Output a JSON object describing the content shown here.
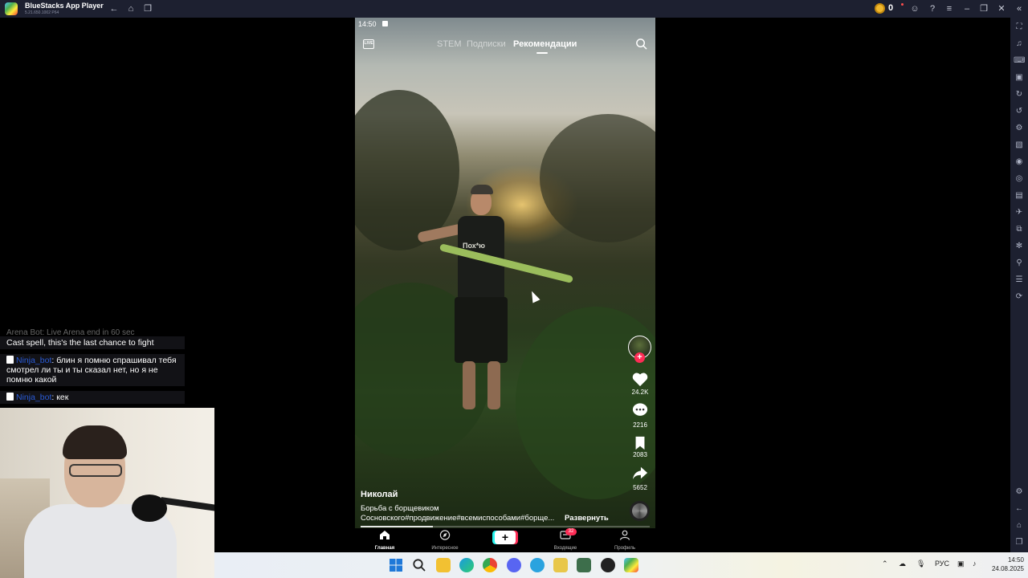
{
  "window": {
    "title": "BlueStacks App Player",
    "version": "5.21.650.1002 P64",
    "coins": "0"
  },
  "phone": {
    "status_time": "14:50",
    "tabs": [
      {
        "label": "STEM",
        "active": false
      },
      {
        "label": "Подписки",
        "active": false
      },
      {
        "label": "Рекомендации",
        "active": true
      }
    ],
    "live_label": "LIVE",
    "shirt_text": "Пох*ю",
    "actions": {
      "likes": "24.2K",
      "comments": "2216",
      "saves": "2083",
      "shares": "5652"
    },
    "author": "Николай",
    "description_line1": "Борьба с борщевиком",
    "description_line2": "Сосновского#продвижение#всемиспособами#борще...",
    "expand_label": "Развернуть",
    "progress": 0.25,
    "nav": [
      {
        "label": "Главная",
        "active": true
      },
      {
        "label": "Интересное",
        "active": false
      },
      {
        "label": "Входящие",
        "active": false
      },
      {
        "label": "Профиль",
        "active": false
      }
    ],
    "inbox_badge": "32",
    "create_label": "+"
  },
  "chat": {
    "faded_line": "Arena Bot: Live Arena end in 60 sec",
    "lines": [
      {
        "user": "",
        "text": "Cast spell, this's the last chance to fight"
      },
      {
        "user": "Ninja_bot",
        "text": ": блин я помню спрашивал тебя смотрел ли ты и ты сказал нет, но я не помню какой"
      },
      {
        "user": "Ninja_bot",
        "text": ": кек"
      }
    ]
  },
  "taskbar": {
    "lang": "РУС",
    "time": "14:50",
    "date": "24.08.2025"
  },
  "colors": {
    "accent_red": "#fe2c55",
    "accent_cyan": "#25f4ee",
    "chrome": "#1d2030"
  }
}
